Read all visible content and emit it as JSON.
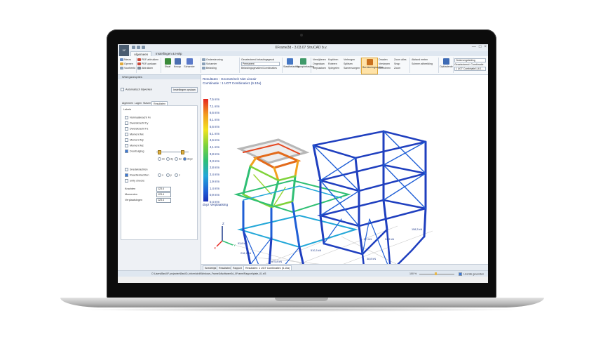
{
  "window": {
    "title": "XFrame3d - 3.03.07   StruCAD b.v.",
    "minimize": "—",
    "maximize": "□",
    "close": "×",
    "logo": "XF"
  },
  "tabs": [
    {
      "label": "Algemeen"
    },
    {
      "label": "Instellingen & Help"
    }
  ],
  "ribbon": {
    "file_items": [
      {
        "label": "Nieuw"
      },
      {
        "label": "Openen"
      },
      {
        "label": "Voorbeeld"
      }
    ],
    "export_items": [
      {
        "label": "PDF-afdrukken"
      },
      {
        "label": "PDF-opslaan"
      },
      {
        "label": "Afdrukken"
      }
    ],
    "undo_label": "",
    "staaf_label": "Staaf",
    "knoop_label": "Knoop",
    "scharnier_label": "Scharnier",
    "side_items": [
      {
        "label": "Ondersteuning"
      },
      {
        "label": "Scharnier"
      },
      {
        "label": "Belasting"
      }
    ],
    "belastinggeval_label": "Belastingsgevallen/Combinaties",
    "select_belasting": "Geselecteerd belastingsgeval",
    "select_belasting_value": "Permanent",
    "staafbelasting_label": "Staafbelasting",
    "knoopbelasting_label": "Knoopbelasting",
    "edit_items": [
      {
        "label": "Verwijderen"
      },
      {
        "label": "Ongedaan"
      },
      {
        "label": "Verplaatsen"
      }
    ],
    "edit_items2": [
      {
        "label": "Kopiëren"
      },
      {
        "label": "Roteren"
      },
      {
        "label": "Spiegelen"
      }
    ],
    "edit_items3": [
      {
        "label": "Verlengen"
      },
      {
        "label": "Splitsen"
      },
      {
        "label": "Samenvoegen"
      }
    ],
    "berekenen_label": "Berekeningsopties",
    "view_items": [
      {
        "label": "Draaien"
      },
      {
        "label": "Verslepen"
      },
      {
        "label": "Selecteren"
      }
    ],
    "view_items2": [
      {
        "label": "Zoom alles"
      },
      {
        "label": "Snap"
      },
      {
        "label": "Zoom"
      }
    ],
    "afstand_label": "Afstand meten",
    "scherm_label": "Scherm afbeelding",
    "weergave_label": "Opbladerde",
    "select_view1": "Ondervergeleiding",
    "select_view2": "Geselecteerd: Combinatie",
    "select_view3": "1 UGT Combinatie1 (6.1..."
  },
  "leftpanel": {
    "header": "Weergaveopties",
    "auto_label": "Automatisch bijwerken",
    "update_button": "Instellingen opslaan",
    "subtabs": [
      {
        "label": "Algemeen"
      },
      {
        "label": "Lagen"
      },
      {
        "label": "Staven"
      },
      {
        "label": "Resultaten"
      }
    ],
    "box_title": "Labels",
    "checkboxes": [
      {
        "label": "Normaalkracht Fx"
      },
      {
        "label": "Dwarskracht Fy"
      },
      {
        "label": "Dwarskracht Fz"
      },
      {
        "label": "Moment Mx"
      },
      {
        "label": "Moment My"
      },
      {
        "label": "Moment Mz"
      },
      {
        "label": "Doorbuiging"
      }
    ],
    "slider_labels": [
      {
        "label": "dx"
      },
      {
        "label": "dy"
      },
      {
        "label": "dz"
      },
      {
        "label": "dxyz"
      }
    ],
    "checkboxes2": [
      {
        "label": "Snedekrachten"
      },
      {
        "label": "Reactiekrachten"
      },
      {
        "label": "unity checks"
      }
    ],
    "radio_labels": [
      {
        "label": "x"
      },
      {
        "label": "y"
      },
      {
        "label": "z"
      }
    ],
    "selects": [
      {
        "label": "Krachten",
        "value": "123.4"
      },
      {
        "label": "Momenten",
        "value": "123.4"
      },
      {
        "label": "Verplaatsingen",
        "value": "123.4"
      }
    ]
  },
  "viewport": {
    "title_lines": [
      "Resultaten - Geometrisch Niet Lineair",
      "Combinatie : 1 UGT Combinatie1 (6.10a)"
    ],
    "legend_caption": "dxyz Verplaatsing",
    "legend_values": [
      "7,5 mm",
      "7,1 mm",
      "6,6 mm",
      "6,1 mm",
      "5,6 mm",
      "5,1 mm",
      "4,6 mm",
      "4,1 mm",
      "3,8 mm",
      "3,3 mm",
      "2,8 mm",
      "2,4 mm",
      "1,9 mm",
      "1,4 mm",
      "0,9 mm",
      "0,4 mm"
    ],
    "axis_labels": {
      "x": "X",
      "y": "Y",
      "z": "Z"
    },
    "reactions": [
      {
        "label": "218,1 kN"
      },
      {
        "label": "93,8 kN"
      },
      {
        "label": "510,3 kN"
      },
      {
        "label": "675,8 kN"
      },
      {
        "label": "38,8 kN"
      },
      {
        "label": "158,3 kN"
      },
      {
        "label": "94,3 kN"
      },
      {
        "label": "0,1 kN"
      }
    ]
  },
  "bottom_tabs": [
    {
      "label": "Snedeliijst"
    },
    {
      "label": "Resultaten"
    },
    {
      "label": "Rapport"
    },
    {
      "label": "Resultaten: 1 UGT Combinatie1 (6.10a)"
    }
  ],
  "status": {
    "path": "C:\\Users\\Bas\\XF-projecten\\Bas\\ID_inform\\civil\\Windows_Frame3d\\software3d_XFrame\\Rapport\\plate_01.xf3",
    "zoom": "100 %",
    "licence": "Licentie gevonden"
  },
  "colors": {
    "accent": "#1f3a8a",
    "ribbon_bg": "#f7f9fb",
    "steel_blue": "#1f3fbf"
  }
}
